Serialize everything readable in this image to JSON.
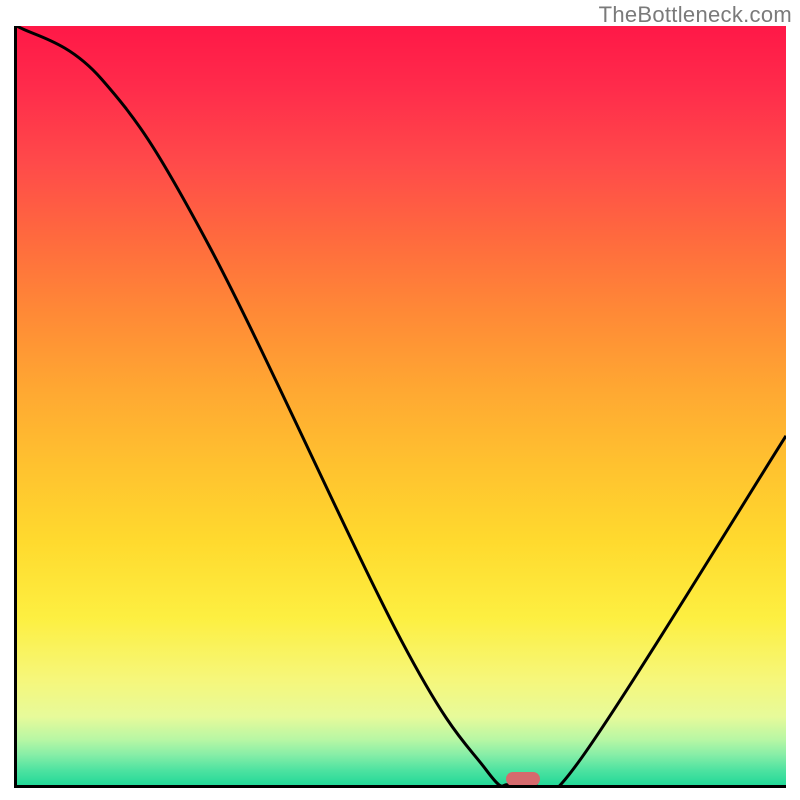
{
  "watermark": "TheBottleneck.com",
  "chart_data": {
    "type": "line",
    "title": "",
    "xlabel": "",
    "ylabel": "",
    "xlim": [
      0,
      100
    ],
    "ylim": [
      0,
      100
    ],
    "x": [
      0,
      11,
      25,
      50,
      61,
      64,
      67,
      73,
      100
    ],
    "values": [
      100,
      93,
      71,
      19,
      2,
      0,
      0,
      3,
      46
    ],
    "marker": {
      "x": 65.5,
      "y": 0
    },
    "background": "vertical-gradient-red-to-green",
    "axes_visible": false
  },
  "colors": {
    "stroke": "#000000",
    "marker": "#d56a6d"
  }
}
